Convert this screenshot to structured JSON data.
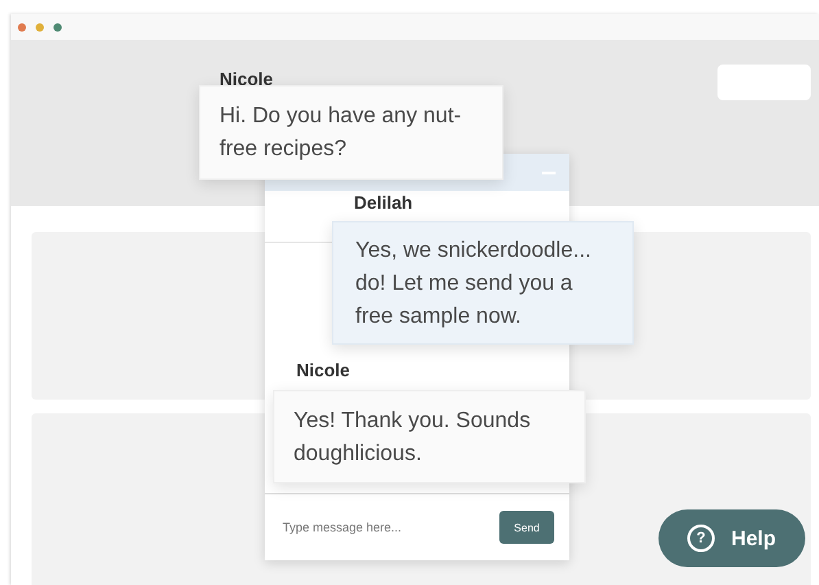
{
  "messages": [
    {
      "sender": "Nicole",
      "text": "Hi. Do you have any nut-free recipes?",
      "kind": "customer"
    },
    {
      "sender": "Delilah",
      "text": "Yes, we snickerdoodle... do! Let me send you a free sample now.",
      "kind": "agent"
    },
    {
      "sender": "Nicole",
      "text": "Yes! Thank you. Sounds doughlicious.",
      "kind": "customer"
    }
  ],
  "composer": {
    "placeholder": "Type message here...",
    "send_label": "Send"
  },
  "help_button": {
    "label": "Help",
    "icon_glyph": "?"
  }
}
